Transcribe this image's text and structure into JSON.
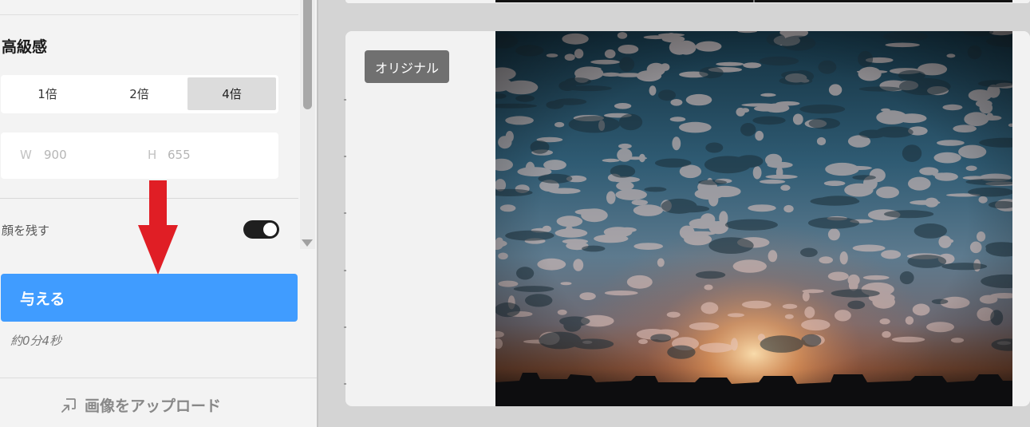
{
  "settings": {
    "section_title": "高級感",
    "scale_options": [
      "1倍",
      "2倍",
      "4倍"
    ],
    "selected_scale": "4倍",
    "width_label": "W",
    "width_value": "900",
    "height_label": "H",
    "height_value": "655",
    "keep_face_label": "顔を残す",
    "keep_face_enabled": true,
    "apply_label": "与える",
    "eta_text": "約0分4秒",
    "upload_label": "画像をアップロード"
  },
  "preview": {
    "badge_label": "オリジナル"
  },
  "colors": {
    "accent": "#409cff",
    "toggle_on": "#1f1f1f",
    "annotation_arrow": "#e01e25"
  },
  "icons": {
    "upload": "upload-image-icon",
    "scroll_down": "triangle-down-icon"
  }
}
